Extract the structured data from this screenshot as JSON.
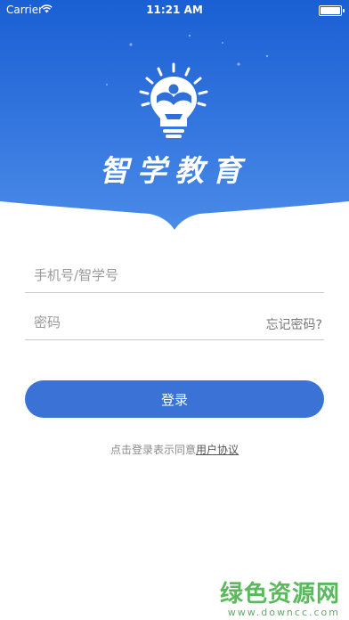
{
  "status_bar": {
    "carrier": "Carrier",
    "time": "11:21 AM"
  },
  "brand": {
    "title": "智学教育",
    "logo_icon": "lightbulb-reading-icon"
  },
  "form": {
    "phone_placeholder": "手机号/智学号",
    "password_placeholder": "密码",
    "forgot_label": "忘记密码?",
    "login_label": "登录"
  },
  "agreement": {
    "prefix": "点击登录表示同意",
    "link_label": "用户协议"
  },
  "watermark": {
    "cn": "绿色资源网",
    "url": "www.downcc.com"
  },
  "colors": {
    "header_top": "#1a5fd4",
    "header_bottom": "#4a8ae8",
    "button": "#3a72d6",
    "watermark": "#5cb85c"
  }
}
